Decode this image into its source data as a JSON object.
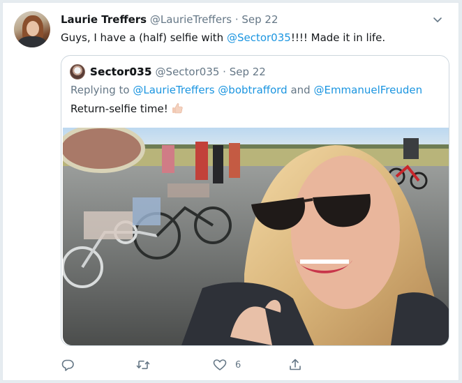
{
  "tweet": {
    "author_name": "Laurie Treffers",
    "author_handle": "@LaurieTreffers",
    "separator": " · ",
    "date": "Sep 22",
    "text_before": "Guys, I have a (half) selfie with ",
    "text_mention": "@Sector035",
    "text_after": "!!!! Made it in life."
  },
  "quote": {
    "author_name": "Sector035",
    "author_handle": "@Sector035",
    "separator": " · ",
    "date": "Sep 22",
    "replying_prefix": "Replying to ",
    "replying_mentions": "@LaurieTreffers @bobtrafford",
    "replying_and": " and ",
    "replying_last": "@EmmanuelFreuden",
    "text": "Return-selfie time!",
    "emoji": "thumbs-up-emoji"
  },
  "actions": {
    "reply_icon": "reply-icon",
    "retweet_icon": "retweet-icon",
    "like_icon": "heart-icon",
    "like_count": "6",
    "share_icon": "share-icon"
  },
  "colors": {
    "link": "#1b95e0",
    "secondary": "#657786",
    "border": "#ccd6dd",
    "text": "#14171a"
  }
}
